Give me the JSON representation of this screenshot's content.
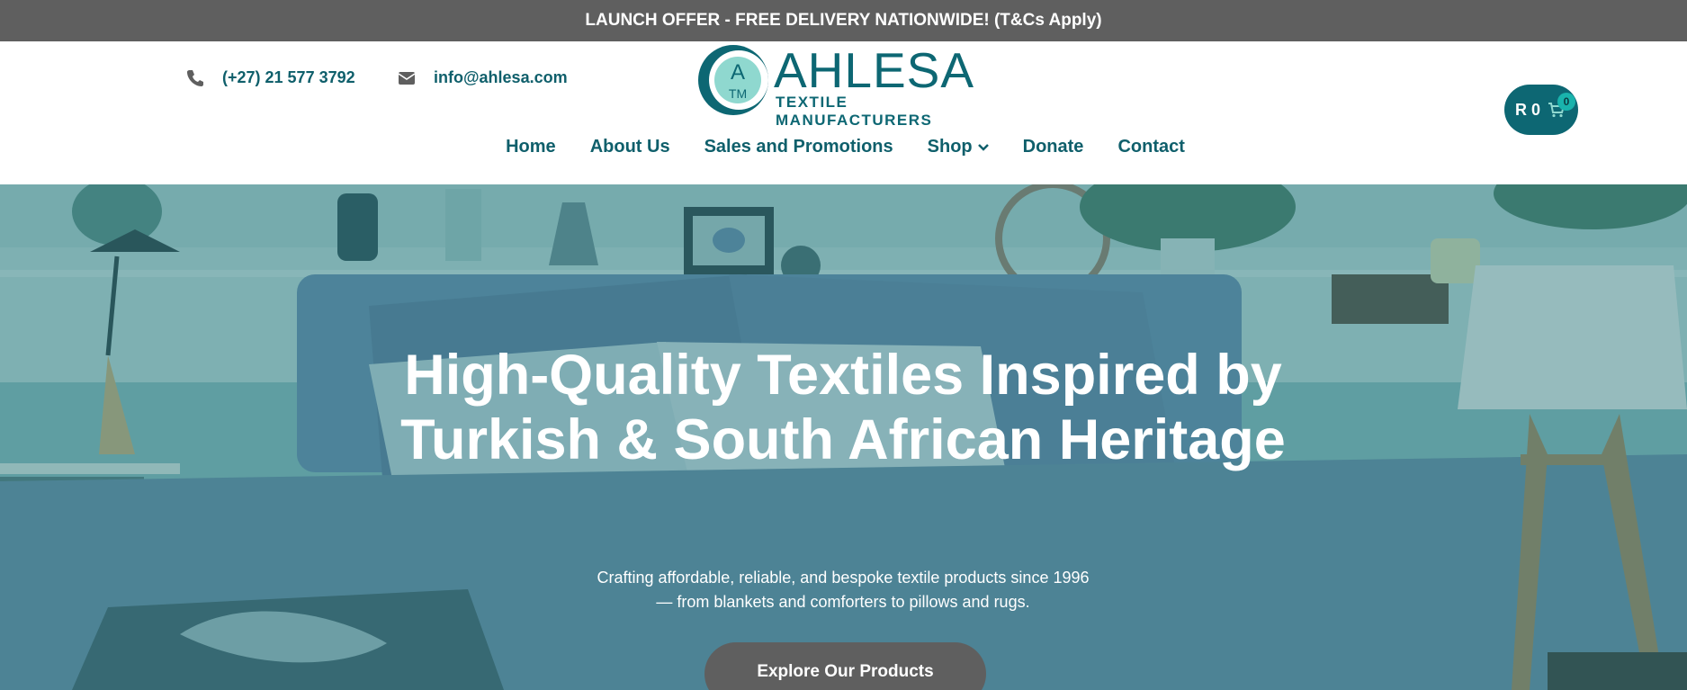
{
  "announcement": {
    "text": "LAUNCH OFFER - FREE DELIVERY NATIONWIDE! (T&Cs Apply)"
  },
  "contact": {
    "phone": "(+27) 21 577 3792",
    "email": "info@ahlesa.com"
  },
  "logo": {
    "mark_top": "A",
    "mark_bottom": "TM",
    "name": "AHLESA",
    "tagline": "TEXTILE MANUFACTURERS"
  },
  "nav": {
    "items": [
      {
        "label": "Home"
      },
      {
        "label": "About Us"
      },
      {
        "label": "Sales and Promotions"
      },
      {
        "label": "Shop"
      },
      {
        "label": "Donate"
      },
      {
        "label": "Contact"
      }
    ]
  },
  "cart": {
    "total": "R 0",
    "count": "0"
  },
  "hero": {
    "title": "High-Quality Textiles Inspired by Turkish & South African Heritage",
    "subtitle": "Crafting affordable, reliable, and bespoke textile products since 1996 — from blankets and comforters to pillows and rugs.",
    "cta": "Explore Our Products"
  },
  "colors": {
    "brand": "#0d6773",
    "topbar": "#5f5f5f",
    "button": "#5f5f5f"
  }
}
